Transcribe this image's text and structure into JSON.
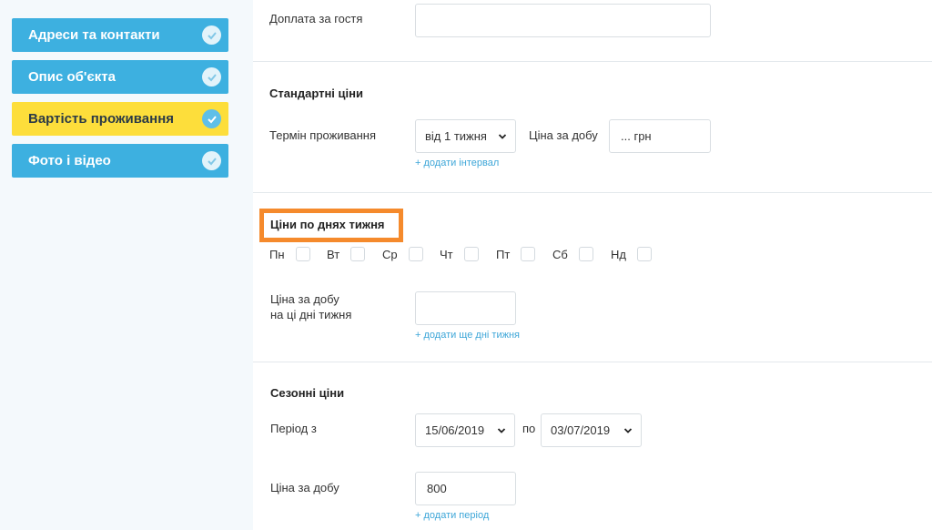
{
  "sidebar": {
    "steps": [
      {
        "label": "Адреси та контакти"
      },
      {
        "label": "Опис об'єкта"
      },
      {
        "label": "Вартість проживання"
      },
      {
        "label": "Фото і відео"
      }
    ]
  },
  "extra_guest": {
    "label": "Доплата за гостя",
    "value": ""
  },
  "standard": {
    "title": "Стандартні ціни",
    "term_label": "Термін проживання",
    "term_value": "від 1 тижня",
    "price_label": "Ціна за добу",
    "price_value": "... грн",
    "add_link": "+ додати інтервал"
  },
  "weekdays": {
    "title": "Ціни по днях тижня",
    "days": [
      "Пн",
      "Вт",
      "Ср",
      "Чт",
      "Пт",
      "Сб",
      "Нд"
    ],
    "price_label_line1": "Ціна за добу",
    "price_label_line2": "на ці дні тижня",
    "price_value": "",
    "add_link": "+ додати ще дні тижня"
  },
  "seasonal": {
    "title": "Сезонні ціни",
    "period_label": "Період з",
    "from_value": "15/06/2019",
    "to_label": "по",
    "to_value": "03/07/2019",
    "price_label": "Ціна за добу",
    "price_value": "800",
    "add_link": "+ додати період"
  },
  "colors": {
    "step_blue": "#3db0e0",
    "step_active": "#fdde3b",
    "highlight": "#f58a2c",
    "link": "#3da6d8"
  }
}
